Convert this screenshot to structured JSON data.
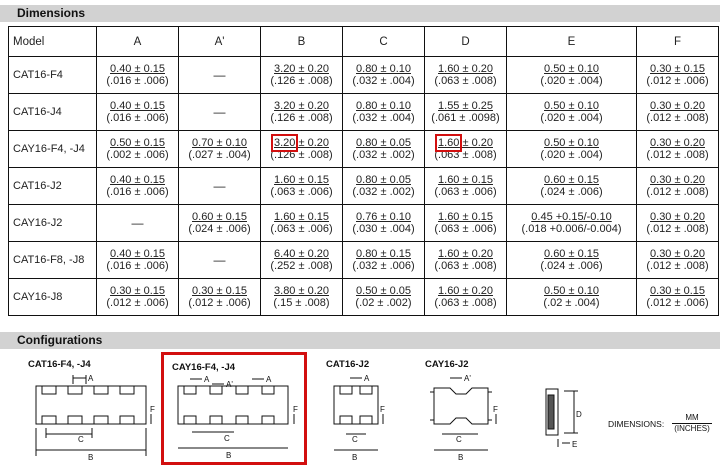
{
  "sections": {
    "dimensions": "Dimensions",
    "configurations": "Configurations"
  },
  "table": {
    "headers": [
      "Model",
      "A",
      "A'",
      "B",
      "C",
      "D",
      "E",
      "F"
    ],
    "rows": [
      {
        "model": "CAT16-F4",
        "cells": [
          {
            "top": "0.40 ± 0.15",
            "bottom": "(.016 ± .006)"
          },
          {
            "dash": "—"
          },
          {
            "top": "3.20 ± 0.20",
            "bottom": "(.126 ± .008)"
          },
          {
            "top": "0.80 ± 0.10",
            "bottom": "(.032 ± .004)"
          },
          {
            "top": "1.60 ± 0.20",
            "bottom": "(.063 ± .008)"
          },
          {
            "top": "0.50 ± 0.10",
            "bottom": "(.020 ± .004)"
          },
          {
            "top": "0.30 ± 0.15",
            "bottom": "(.012 ± .006)"
          }
        ]
      },
      {
        "model": "CAT16-J4",
        "cells": [
          {
            "top": "0.40 ± 0.15",
            "bottom": "(.016 ± .006)"
          },
          {
            "dash": "—"
          },
          {
            "top": "3.20 ± 0.20",
            "bottom": "(.126 ± .008)"
          },
          {
            "top": "0.80 ± 0.10",
            "bottom": "(.032 ± .004)"
          },
          {
            "top": "1.55 ± 0.25",
            "bottom": "(.061 ± .0098)"
          },
          {
            "top": "0.50 ± 0.10",
            "bottom": "(.020 ± .004)"
          },
          {
            "top": "0.30 ± 0.20",
            "bottom": "(.012 ± .008)"
          }
        ]
      },
      {
        "model": "CAY16-F4, -J4",
        "cells": [
          {
            "top": "0.50 ± 0.15",
            "bottom": "(.002 ± .006)"
          },
          {
            "top": "0.70 ± 0.10",
            "bottom": "(.027 ± .004)"
          },
          {
            "top_hl": "3.20",
            "top_rest": " ± 0.20",
            "bottom": "(.126 ± .008)"
          },
          {
            "top": "0.80 ± 0.05",
            "bottom": "(.032 ± .002)"
          },
          {
            "top_hl": "1.60",
            "top_rest": " ± 0.20",
            "bottom": "(.063 ± .008)"
          },
          {
            "top": "0.50 ± 0.10",
            "bottom": "(.020 ± .004)"
          },
          {
            "top": "0.30 ± 0.20",
            "bottom": "(.012 ± .008)"
          }
        ]
      },
      {
        "model": "CAT16-J2",
        "cells": [
          {
            "top": "0.40 ± 0.15",
            "bottom": "(.016 ± .006)"
          },
          {
            "dash": "—"
          },
          {
            "top": "1.60 ± 0.15",
            "bottom": "(.063 ± .006)"
          },
          {
            "top": "0.80 ± 0.05",
            "bottom": "(.032 ± .002)"
          },
          {
            "top": "1.60 ± 0.15",
            "bottom": "(.063 ± .006)"
          },
          {
            "top": "0.60 ± 0.15",
            "bottom": "(.024 ± .006)"
          },
          {
            "top": "0.30 ± 0.20",
            "bottom": "(.012 ± .008)"
          }
        ]
      },
      {
        "model": "CAY16-J2",
        "cells": [
          {
            "dash": "—"
          },
          {
            "top": "0.60 ± 0.15",
            "bottom": "(.024 ± .006)"
          },
          {
            "top": "1.60 ± 0.15",
            "bottom": "(.063 ± .006)"
          },
          {
            "top": "0.76 ± 0.10",
            "bottom": "(.030 ± .004)"
          },
          {
            "top": "1.60 ± 0.15",
            "bottom": "(.063 ± .006)"
          },
          {
            "top": "0.45 +0.15/-0.10",
            "bottom": "(.018 +0.006/-0.004)"
          },
          {
            "top": "0.30 ± 0.20",
            "bottom": "(.012 ± .008)"
          }
        ]
      },
      {
        "model": "CAT16-F8, -J8",
        "cells": [
          {
            "top": "0.40 ± 0.15",
            "bottom": "(.016 ± .006)"
          },
          {
            "dash": "—"
          },
          {
            "top": "6.40 ± 0.20",
            "bottom": "(.252 ± .008)"
          },
          {
            "top": "0.80 ± 0.15",
            "bottom": "(.032 ± .006)"
          },
          {
            "top": "1.60 ± 0.20",
            "bottom": "(.063 ± .008)"
          },
          {
            "top": "0.60 ± 0.15",
            "bottom": "(.024 ± .006)"
          },
          {
            "top": "0.30 ± 0.20",
            "bottom": "(.012 ± .008)"
          }
        ]
      },
      {
        "model": "CAY16-J8",
        "cells": [
          {
            "top": "0.30 ± 0.15",
            "bottom": "(.012 ± .006)"
          },
          {
            "top": "0.30 ± 0.15",
            "bottom": "(.012 ± .006)"
          },
          {
            "top": "3.80 ± 0.20",
            "bottom": "(.15 ± .008)"
          },
          {
            "top": "0.50 ± 0.05",
            "bottom": "(.02 ± .002)"
          },
          {
            "top": "1.60 ± 0.20",
            "bottom": "(.063 ± .008)"
          },
          {
            "top": "0.50 ± 0.10",
            "bottom": "(.02 ± .004)"
          },
          {
            "top": "0.30 ± 0.15",
            "bottom": "(.012 ± .006)"
          }
        ]
      }
    ]
  },
  "configurations": {
    "labels": [
      "CAT16-F4, -J4",
      "CAY16-F4, -J4",
      "CAT16-J2",
      "CAY16-J2"
    ],
    "dim_letters": {
      "a": "A",
      "a_prime": "A'",
      "b": "B",
      "c": "C",
      "d": "D",
      "e": "E",
      "f": "F"
    },
    "units_label": "DIMENSIONS:",
    "units_top": "MM",
    "units_bottom": "(INCHES)"
  },
  "colors": {
    "highlight": "#d20f0f",
    "section_bar": "#d2d2d2"
  }
}
